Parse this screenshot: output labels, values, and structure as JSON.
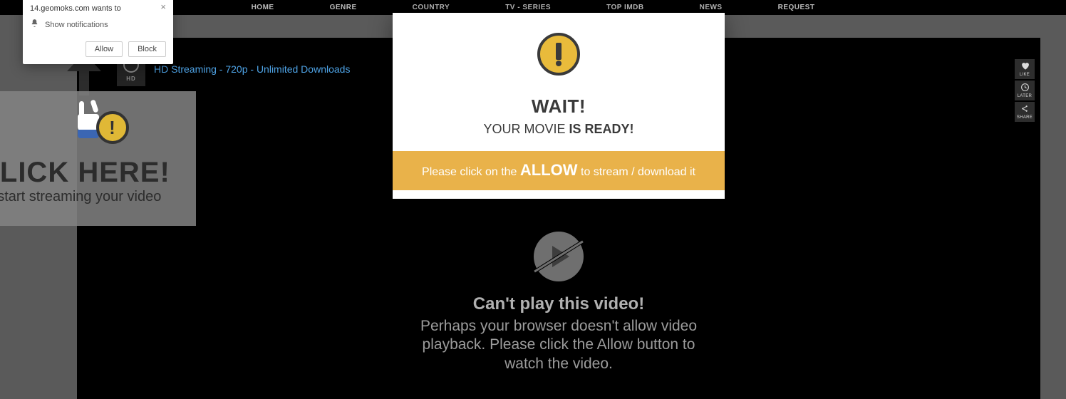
{
  "nav": {
    "items": [
      "HOME",
      "GENRE",
      "COUNTRY",
      "TV - SERIES",
      "TOP IMDB",
      "NEWS",
      "REQUEST"
    ]
  },
  "hd_link": {
    "label": "HD Streaming - 720p - Unlimited Downloads",
    "icon_text": "HD"
  },
  "rail": {
    "like": "LIKE",
    "later": "LATER",
    "share": "SHARE"
  },
  "cant_play": {
    "heading": "Can't play this video!",
    "body": "Perhaps your browser doesn't allow video playback. Please click the Allow button to watch the video."
  },
  "click_panel": {
    "heading": "CLICK HERE!",
    "sub": "to start streaming your video"
  },
  "notif": {
    "origin": "14.geomoks.com wants to",
    "msg": "Show notifications",
    "allow": "Allow",
    "block": "Block",
    "close": "×"
  },
  "modal": {
    "heading": "WAIT!",
    "sub_pre": "YOUR MOVIE ",
    "sub_strong": "IS READY!",
    "bar_pre": "Please click on the ",
    "bar_allow": "ALLOW",
    "bar_post": " to stream / download it"
  }
}
